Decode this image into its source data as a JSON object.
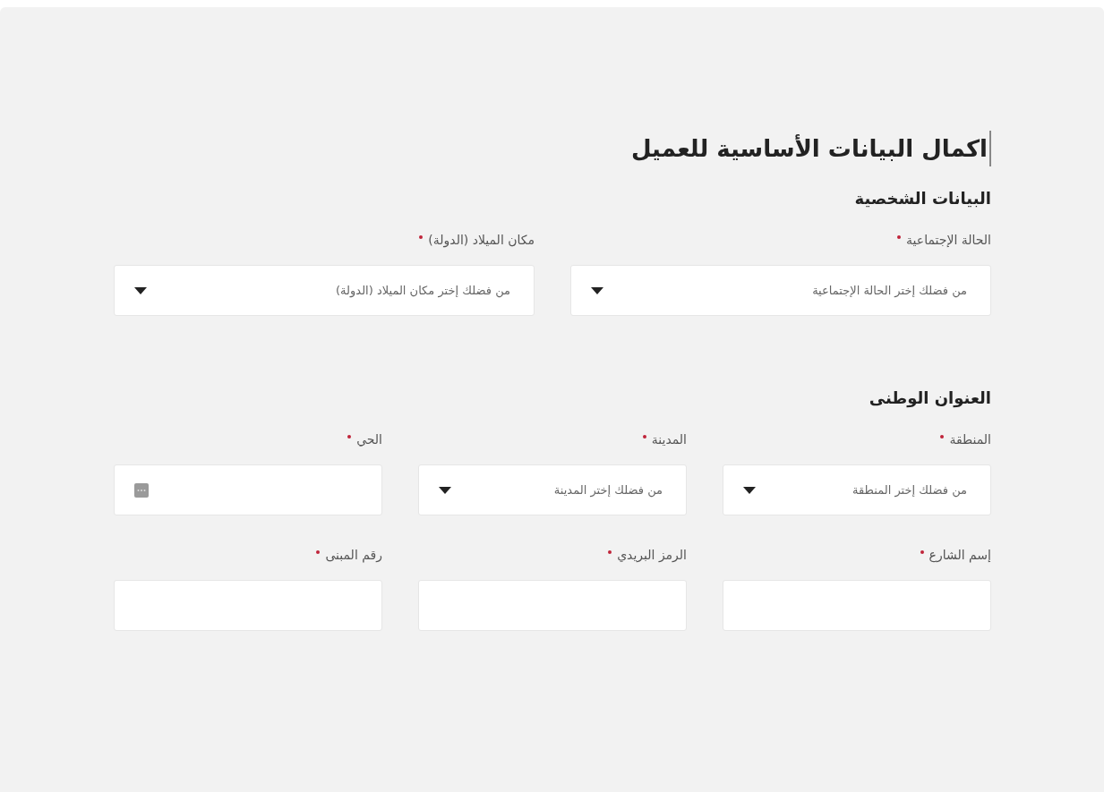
{
  "title": "اكمال البيانات الأساسية للعميل",
  "sections": [
    {
      "heading": "البيانات الشخصية",
      "rows": [
        [
          {
            "label": "الحالة الإجتماعية",
            "required": true,
            "kind": "select",
            "placeholder": "من فضلك إختر الحالة الإجتماعية"
          },
          {
            "label": "مكان الميلاد (الدولة)",
            "required": true,
            "kind": "select",
            "placeholder": "من فضلك إختر مكان الميلاد (الدولة)"
          }
        ]
      ]
    },
    {
      "heading": "العنوان الوطنى",
      "rows": [
        [
          {
            "label": "المنطقة",
            "required": true,
            "kind": "select",
            "placeholder": "من فضلك إختر المنطقة"
          },
          {
            "label": "المدينة",
            "required": true,
            "kind": "select",
            "placeholder": "من فضلك إختر المدينة"
          },
          {
            "label": "الحي",
            "required": true,
            "kind": "lookup"
          }
        ],
        [
          {
            "label": "إسم الشارع",
            "required": true,
            "kind": "input"
          },
          {
            "label": "الرمز البريدي",
            "required": true,
            "kind": "input"
          },
          {
            "label": "رقم المبنى",
            "required": true,
            "kind": "input"
          }
        ]
      ]
    }
  ]
}
